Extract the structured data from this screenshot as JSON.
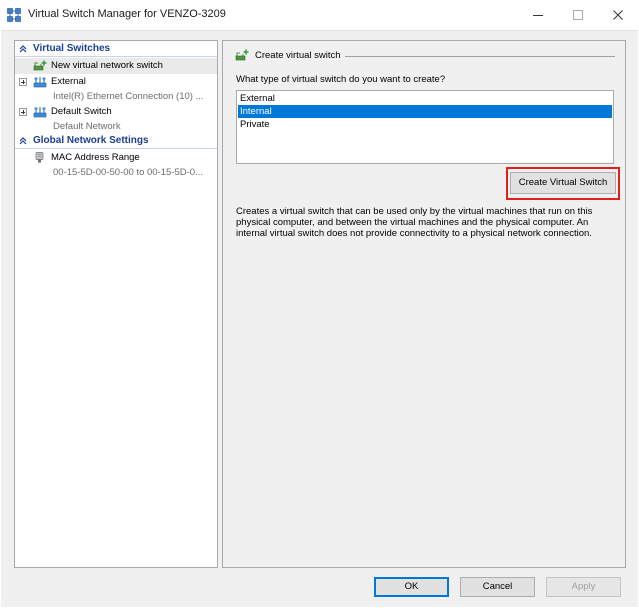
{
  "window": {
    "title": "Virtual Switch Manager for VENZO-3209",
    "icon": "hyper-v-switch-icon",
    "controls": [
      "minimize-icon",
      "maximize-icon",
      "close-icon"
    ]
  },
  "sidebar": {
    "virtual_switches_header": "Virtual Switches",
    "new_switch_label": "New virtual network switch",
    "switches": [
      {
        "name": "External",
        "detail": "Intel(R) Ethernet Connection (10) ..."
      },
      {
        "name": "Default Switch",
        "detail": "Default Network"
      }
    ],
    "global_header": "Global Network Settings",
    "mac_range": {
      "name": "MAC Address Range",
      "detail": "00-15-5D-00-50-00 to 00-15-5D-0..."
    }
  },
  "main": {
    "panel_title": "Create virtual switch",
    "question": "What type of virtual switch do you want to create?",
    "switch_types": [
      "External",
      "Internal",
      "Private"
    ],
    "selected_type": "Internal",
    "create_button": "Create Virtual Switch",
    "description": "Creates a virtual switch that can be used only by the virtual machines that run on this physical computer, and between the virtual machines and the physical computer. An internal virtual switch does not provide connectivity to a physical network connection."
  },
  "footer": {
    "ok": "OK",
    "cancel": "Cancel",
    "apply": "Apply"
  },
  "colors": {
    "selection": "#0078d7",
    "header_text": "#1c3f94",
    "highlight": "#e0201b"
  }
}
